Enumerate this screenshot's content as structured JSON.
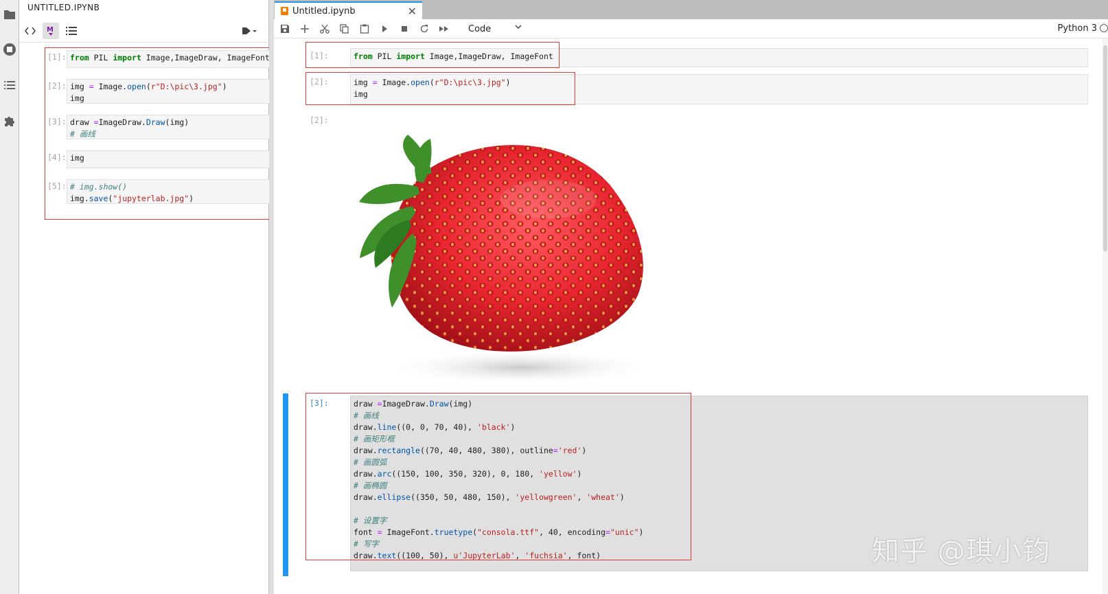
{
  "sidebar": {
    "title": "UNTITLED.IPYNB",
    "cells": [
      {
        "prompt": "[1]:"
      },
      {
        "prompt": "[2]:"
      },
      {
        "prompt": "[3]:"
      },
      {
        "prompt": "[4]:"
      },
      {
        "prompt": "[5]:"
      }
    ]
  },
  "tab": {
    "label": "Untitled.ipynb",
    "close": "✕"
  },
  "toolbar": {
    "cell_type": "Code",
    "kernel": "Python 3"
  },
  "cells": [
    {
      "prompt": "[1]:"
    },
    {
      "prompt": "[2]:"
    },
    {
      "prompt": "[2]:"
    },
    {
      "prompt": "[3]:"
    }
  ],
  "code": {
    "c1": {
      "from": "from",
      "mod": " PIL ",
      "imp": "import",
      "rest": " Image,ImageDraw, ImageFont"
    },
    "c2": {
      "l1a": "img ",
      "eq": "=",
      "l1b": " Image.",
      "open": "open",
      "l1c": "(",
      "s": "r\"D:\\pic\\3.jpg\"",
      "l1d": ")",
      "l2": "img"
    },
    "c3": {
      "a1": "draw ",
      "a2": "=",
      "a3": "ImageDraw.",
      "a4": "Draw",
      "a5": "(img)",
      "c_line": "# 画线",
      "b1": "draw.",
      "b2": "line",
      "b3": "((0, 0, 70, 40), ",
      "b4": "'black'",
      "b5": ")",
      "c_rect": "# 画矩形框",
      "d1": "draw.",
      "d2": "rectangle",
      "d3": "((70, 40, 480, 380), outline",
      "d4": "=",
      "d5": "'red'",
      "d6": ")",
      "c_arc": "# 画圆弧",
      "e1": "draw.",
      "e2": "arc",
      "e3": "((150, 100, 350, 320), 0, 180, ",
      "e4": "'yellow'",
      "e5": ")",
      "c_ell": "# 画椭圆",
      "f1": "draw.",
      "f2": "ellipse",
      "f3": "((350, 50, 480, 150), ",
      "f4": "'yellowgreen'",
      "f5": ", ",
      "f6": "'wheat'",
      "f7": ")",
      "c_font": "# 设置字",
      "g1": "font ",
      "g2": "=",
      "g3": " ImageFont.",
      "g4": "truetype",
      "g5": "(",
      "g6": "\"consola.ttf\"",
      "g7": ", 40, encoding",
      "g8": "=",
      "g9": "\"unic\"",
      "g10": ")",
      "c_text": "# 写字",
      "h1": "draw.",
      "h2": "text",
      "h3": "((100, 50), ",
      "h4": "u'JupyterLab'",
      "h5": ", ",
      "h6": "'fuchsia'",
      "h7": ", font)"
    },
    "c3_short": {
      "c_line": "# 画线"
    },
    "c4": {
      "l1": "img"
    },
    "c5": {
      "cm": "# img.show()",
      "a": "img.",
      "fn": "save",
      "b": "(",
      "s": "\"jupyterlab.jpg\"",
      "c": ")"
    }
  },
  "watermark": "知乎 @琪小钧",
  "colors": {
    "accent": "#2196f3",
    "highlight": "#e53935",
    "strawberry": "#e8262f",
    "leaf": "#3f8f2b"
  }
}
